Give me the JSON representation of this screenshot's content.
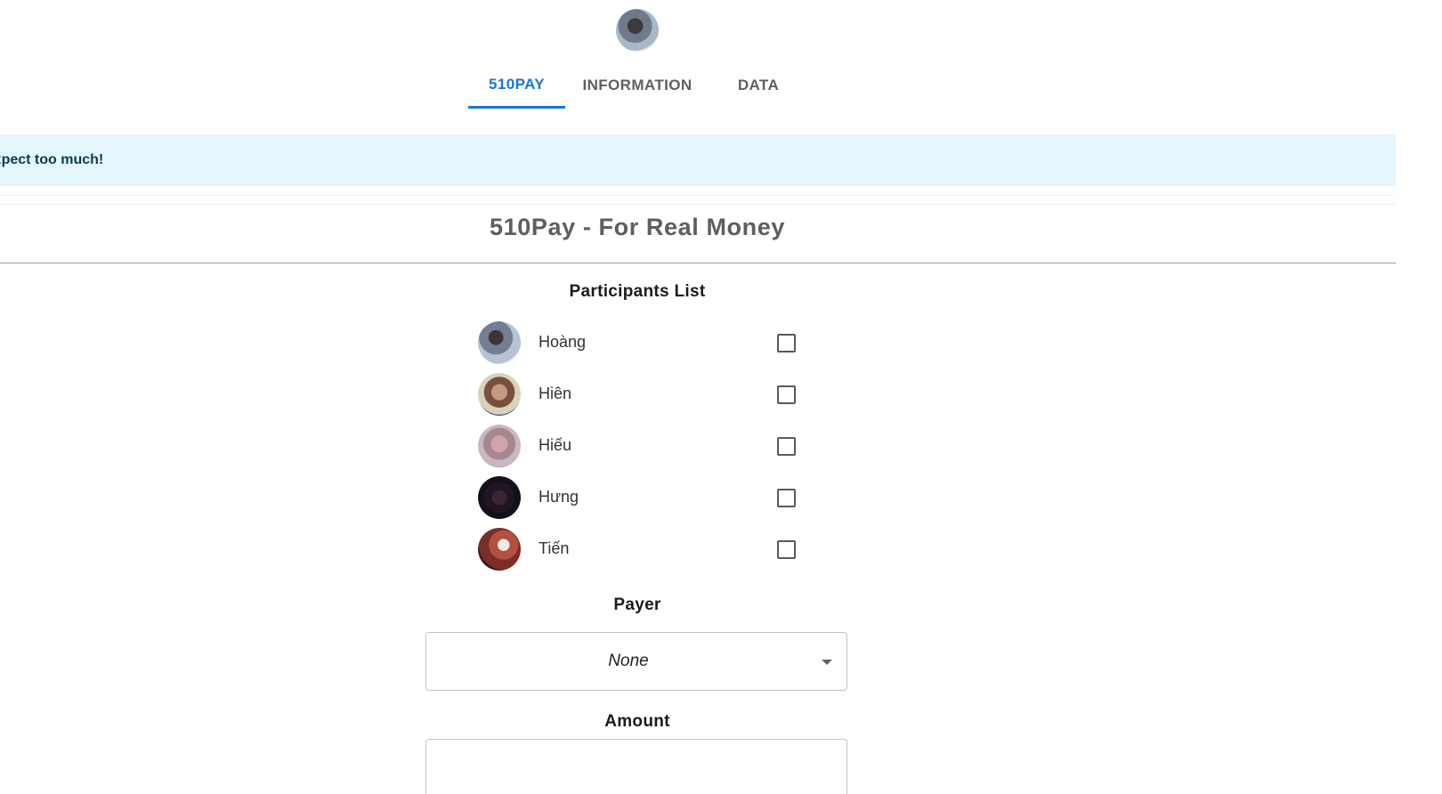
{
  "header": {
    "avatar_icon": "user-avatar"
  },
  "tabs": [
    {
      "label": "510PAY",
      "active": true
    },
    {
      "label": "INFORMATION",
      "active": false
    },
    {
      "label": "DATA",
      "active": false
    }
  ],
  "banner": {
    "text": "t expect too much!"
  },
  "page": {
    "title": "510Pay - For Real Money"
  },
  "participants": {
    "label": "Participants List",
    "items": [
      {
        "name": "Hoàng",
        "checked": false
      },
      {
        "name": "Hiên",
        "checked": false
      },
      {
        "name": "Hiếu",
        "checked": false
      },
      {
        "name": "Hưng",
        "checked": false
      },
      {
        "name": "Tiến",
        "checked": false
      }
    ]
  },
  "payer": {
    "label": "Payer",
    "selected": "None"
  },
  "amount": {
    "label": "Amount",
    "value": ""
  },
  "colors": {
    "accent": "#1976d2",
    "banner_bg": "#e5f6fd",
    "banner_text": "#0b3b52"
  }
}
